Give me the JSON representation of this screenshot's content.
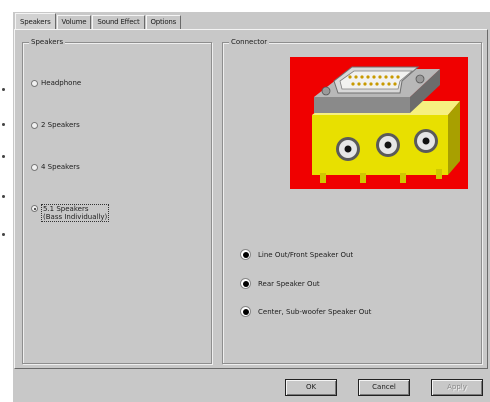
{
  "tabs": [
    {
      "label": "Speakers",
      "active": true
    },
    {
      "label": "Volume",
      "active": false
    },
    {
      "label": "Sound Effect",
      "active": false
    },
    {
      "label": "Options",
      "active": false
    }
  ],
  "speakers_group": {
    "title": "Speakers",
    "options": [
      {
        "label": "Headphone",
        "selected": false
      },
      {
        "label": "2 Speakers",
        "selected": false
      },
      {
        "label": "4 Speakers",
        "selected": false
      },
      {
        "label_line1": "5.1 Speakers",
        "label_line2": "(Bass Individually)",
        "selected": true
      }
    ]
  },
  "connector_group": {
    "title": "Connector",
    "image_background": "#f00000",
    "outputs": [
      "Line Out/Front Speaker Out",
      "Rear Speaker Out",
      "Center, Sub-woofer Speaker Out"
    ]
  },
  "buttons": {
    "ok": "OK",
    "cancel": "Cancel",
    "apply": "Apply"
  }
}
